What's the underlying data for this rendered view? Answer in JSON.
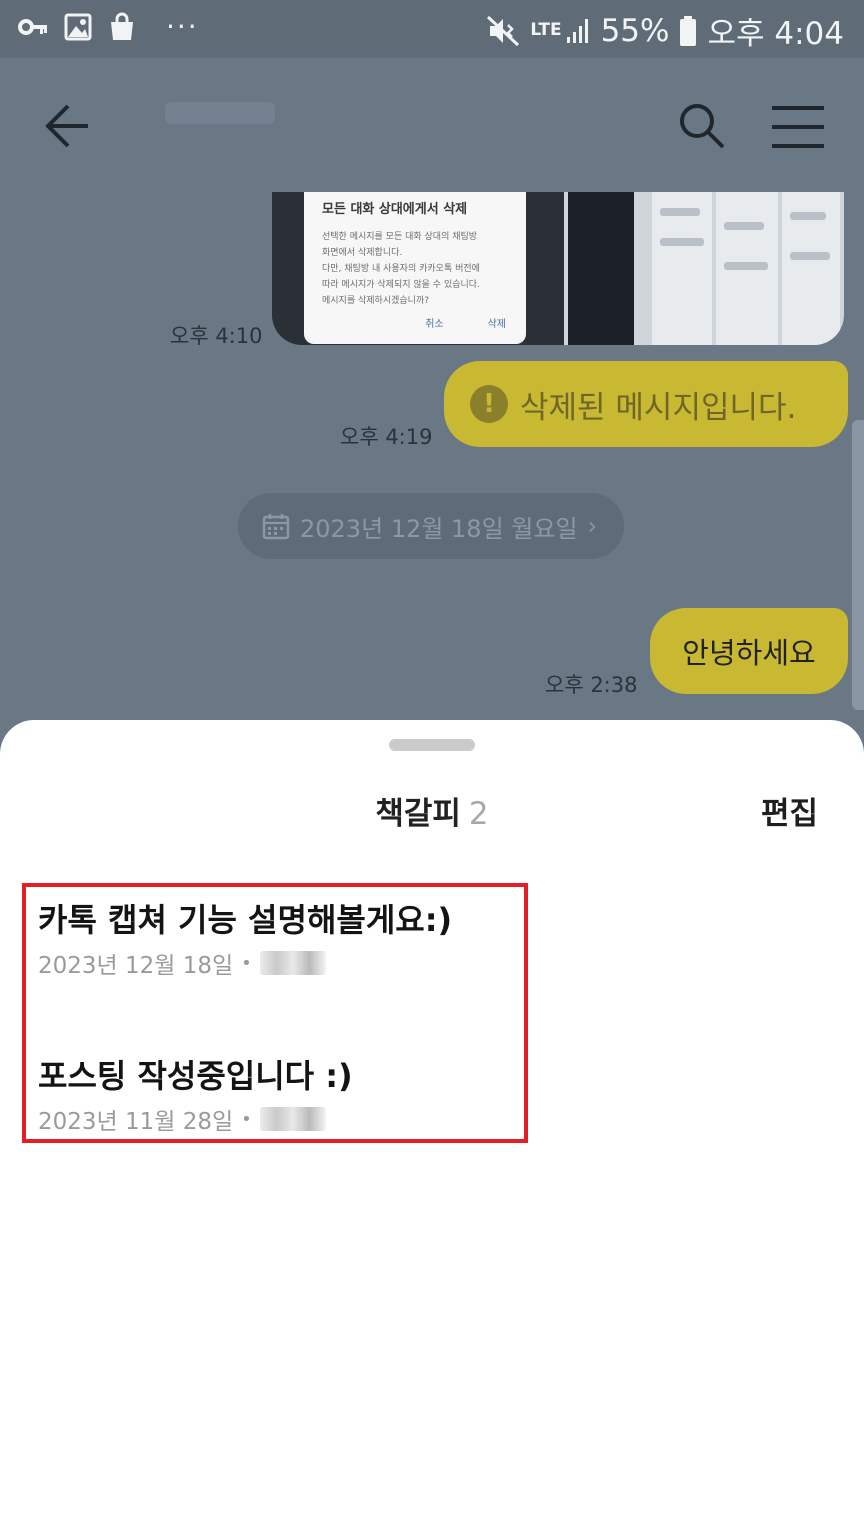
{
  "status_bar": {
    "battery": "55%",
    "network": "LTE",
    "time": "오후 4:04",
    "more": "···"
  },
  "chat": {
    "screenshot_dialog": {
      "title": "모든 대화 상대에게서 삭제",
      "body_lines": [
        "선택한 메시지를 모든 대화 상대의 채팅방",
        "화면에서 삭제합니다.",
        "다만, 채팅방 내 사용자의 카카오톡 버전에",
        "따라 메시지가 삭제되지 않을 수 있습니다.",
        "메시지를 삭제하시겠습니까?"
      ],
      "cancel_label": "취소",
      "delete_label": "삭제"
    },
    "messages": [
      {
        "time": "오후 4:10"
      },
      {
        "time": "오후 4:19",
        "text": "삭제된 메시지입니다."
      },
      {
        "time": "오후 2:38",
        "text": "안녕하세요"
      }
    ],
    "date_divider": "2023년 12월 18일 월요일",
    "date_chevron": "›"
  },
  "sheet": {
    "title": "책갈피",
    "count": "2",
    "edit_label": "편집",
    "bookmarks": [
      {
        "title": "카톡 캡쳐 기능 설명해볼게요:)",
        "date": "2023년 12월 18일"
      },
      {
        "title": "포스팅 작성중입니다 :)",
        "date": "2023년 11월 28일"
      }
    ]
  },
  "colors": {
    "dim_overlay": "#6a7886",
    "bubble": "#c9b932",
    "highlight": "#e31e24"
  }
}
